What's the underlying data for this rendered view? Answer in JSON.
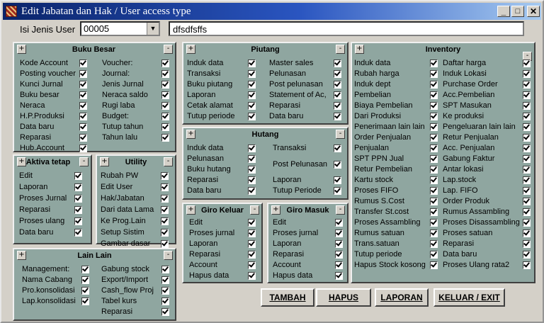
{
  "window": {
    "title": "Edit Jabatan dan Hak / User access type",
    "controls": {
      "minimize": "_",
      "maximize": "□",
      "close": "✕"
    }
  },
  "form": {
    "label": "Isi Jenis User",
    "code_value": "00005",
    "name_value": "dfsdfsffs"
  },
  "panels": [
    {
      "key": "bukubesar",
      "title": "Buku Besar",
      "items": [
        {
          "label": "Kode Account",
          "checked": true
        },
        {
          "label": "Posting voucher",
          "checked": true
        },
        {
          "label": "Kunci Jurnal",
          "checked": true
        },
        {
          "label": "Buku besar",
          "checked": true
        },
        {
          "label": "Neraca",
          "checked": true
        },
        {
          "label": "H.P.Produksi",
          "checked": true
        },
        {
          "label": "Data baru",
          "checked": true
        },
        {
          "label": "Reparasi",
          "checked": true
        },
        {
          "label": "Hub.Account",
          "checked": true
        },
        {
          "label": "Voucher:",
          "checked": true
        },
        {
          "label": "Journal:",
          "checked": true
        },
        {
          "label": "Jenis Jurnal",
          "checked": true
        },
        {
          "label": "Neraca saldo",
          "checked": true
        },
        {
          "label": "Rugi laba",
          "checked": true
        },
        {
          "label": "Budget:",
          "checked": true
        },
        {
          "label": "Tutup tahun",
          "checked": true
        },
        {
          "label": "Tahun lalu",
          "checked": true
        }
      ]
    },
    {
      "key": "aktiva",
      "title": "Aktiva tetap",
      "items": [
        {
          "label": "Edit",
          "checked": true
        },
        {
          "label": "Laporan",
          "checked": true
        },
        {
          "label": "Proses Jurnal",
          "checked": true
        },
        {
          "label": "Reparasi",
          "checked": true
        },
        {
          "label": "Proses ulang",
          "checked": true
        },
        {
          "label": "Data baru",
          "checked": true
        }
      ]
    },
    {
      "key": "utility",
      "title": "Utility",
      "items": [
        {
          "label": "Rubah PW",
          "checked": true
        },
        {
          "label": "Edit User",
          "checked": true
        },
        {
          "label": "Hak/Jabatan",
          "checked": true
        },
        {
          "label": "Dari data Lama",
          "checked": true
        },
        {
          "label": "Ke Prog.Lain",
          "checked": true
        },
        {
          "label": "Setup Sistim",
          "checked": true
        },
        {
          "label": "Gambar dasar",
          "checked": true
        }
      ]
    },
    {
      "key": "lainlain",
      "title": "Lain Lain",
      "items": [
        {
          "label": "Management:",
          "checked": true
        },
        {
          "label": "Nama Cabang",
          "checked": true
        },
        {
          "label": "Pro.konsolidasi",
          "checked": true
        },
        {
          "label": "Lap.konsolidasi",
          "checked": true
        },
        {
          "label": "Gabung stock",
          "checked": true
        },
        {
          "label": "Export/Import",
          "checked": true
        },
        {
          "label": "Cash_flow Proj",
          "checked": true
        },
        {
          "label": "Tabel kurs",
          "checked": true
        },
        {
          "label": "Reparasi",
          "checked": true
        }
      ]
    },
    {
      "key": "piutang",
      "title": "Piutang",
      "items": [
        {
          "label": "Induk data",
          "checked": true
        },
        {
          "label": "Transaksi",
          "checked": true
        },
        {
          "label": "Buku piutang",
          "checked": true
        },
        {
          "label": "Laporan",
          "checked": true
        },
        {
          "label": "Cetak alamat",
          "checked": true
        },
        {
          "label": "Tutup periode",
          "checked": true
        },
        {
          "label": "Master sales",
          "checked": true
        },
        {
          "label": "Pelunasan",
          "checked": true
        },
        {
          "label": "Post pelunasan",
          "checked": true
        },
        {
          "label": "Statement of Ac,",
          "checked": true
        },
        {
          "label": "Reparasi",
          "checked": true
        },
        {
          "label": "Data baru",
          "checked": true
        }
      ]
    },
    {
      "key": "hutang",
      "title": "Hutang",
      "items": [
        {
          "label": "Induk data",
          "checked": true
        },
        {
          "label": "Pelunasan",
          "checked": true
        },
        {
          "label": "Buku hutang",
          "checked": true
        },
        {
          "label": "Reparasi",
          "checked": true
        },
        {
          "label": "Data baru",
          "checked": true
        },
        {
          "label": "Transaksi",
          "checked": true
        },
        {
          "label": "Post Pelunasan",
          "checked": true
        },
        {
          "label": "Laporan",
          "checked": true
        },
        {
          "label": "Tutup Periode",
          "checked": true
        }
      ]
    },
    {
      "key": "girokeluar",
      "title": "Giro Keluar",
      "items": [
        {
          "label": "Edit",
          "checked": true
        },
        {
          "label": "Proses jurnal",
          "checked": true
        },
        {
          "label": "Laporan",
          "checked": true
        },
        {
          "label": "Reparasi",
          "checked": true
        },
        {
          "label": "Account",
          "checked": true
        },
        {
          "label": "Hapus data",
          "checked": true
        }
      ]
    },
    {
      "key": "giromasuk",
      "title": "Giro Masuk",
      "items": [
        {
          "label": "Edit",
          "checked": true
        },
        {
          "label": "Proses jurnal",
          "checked": true
        },
        {
          "label": "Laporan",
          "checked": true
        },
        {
          "label": "Reparasi",
          "checked": true
        },
        {
          "label": "Account",
          "checked": true
        },
        {
          "label": "Hapus data",
          "checked": true
        }
      ]
    },
    {
      "key": "inventory",
      "title": "Inventory",
      "items": [
        {
          "label": "Induk data",
          "checked": true
        },
        {
          "label": "Rubah harga",
          "checked": true
        },
        {
          "label": "Induk dept",
          "checked": true
        },
        {
          "label": "Pembelian",
          "checked": true
        },
        {
          "label": "Biaya Pembelian",
          "checked": true
        },
        {
          "label": "Dari Produksi",
          "checked": true
        },
        {
          "label": "Penerimaan lain lain",
          "checked": true
        },
        {
          "label": "Order Penjualan",
          "checked": true
        },
        {
          "label": "Penjualan",
          "checked": true
        },
        {
          "label": "SPT PPN Jual",
          "checked": true
        },
        {
          "label": "Retur Pembelian",
          "checked": true
        },
        {
          "label": "Kartu stock",
          "checked": true
        },
        {
          "label": "Proses FIFO",
          "checked": true
        },
        {
          "label": "Rumus S.Cost",
          "checked": true
        },
        {
          "label": "Transfer St.cost",
          "checked": true
        },
        {
          "label": "Proses Assambling",
          "checked": true
        },
        {
          "label": "Rumus satuan",
          "checked": true
        },
        {
          "label": "Trans.satuan",
          "checked": true
        },
        {
          "label": "Tutup periode",
          "checked": true
        },
        {
          "label": "Hapus Stock kosong",
          "checked": true
        },
        {
          "label": "Daftar harga",
          "checked": true
        },
        {
          "label": "Induk Lokasi",
          "checked": true
        },
        {
          "label": "Purchase Order",
          "checked": true
        },
        {
          "label": "Acc.Pembelian",
          "checked": true
        },
        {
          "label": "SPT Masukan",
          "checked": true
        },
        {
          "label": "Ke produksi",
          "checked": true
        },
        {
          "label": "Pengeluaran lain lain",
          "checked": true
        },
        {
          "label": "Retur Penjualan",
          "checked": true
        },
        {
          "label": "Acc. Penjualan",
          "checked": true
        },
        {
          "label": "Gabung Faktur",
          "checked": true
        },
        {
          "label": "Antar lokasi",
          "checked": true
        },
        {
          "label": "Lap.stock",
          "checked": true
        },
        {
          "label": "Lap. FIFO",
          "checked": true
        },
        {
          "label": "Order Produk",
          "checked": true
        },
        {
          "label": "Rumus Assambling",
          "checked": true
        },
        {
          "label": "Proses Disassambling",
          "checked": true
        },
        {
          "label": "Proses satuan",
          "checked": true
        },
        {
          "label": "Reparasi",
          "checked": true
        },
        {
          "label": "Data baru",
          "checked": true
        },
        {
          "label": "Proses Ulang rata2",
          "checked": true
        }
      ]
    }
  ],
  "panel_buttons": {
    "expand": "+",
    "collapse": "-"
  },
  "buttons": {
    "tambah": "TAMBAH",
    "hapus": "HAPUS",
    "laporan": "LAPORAN",
    "keluar": "KELUAR / EXIT"
  }
}
